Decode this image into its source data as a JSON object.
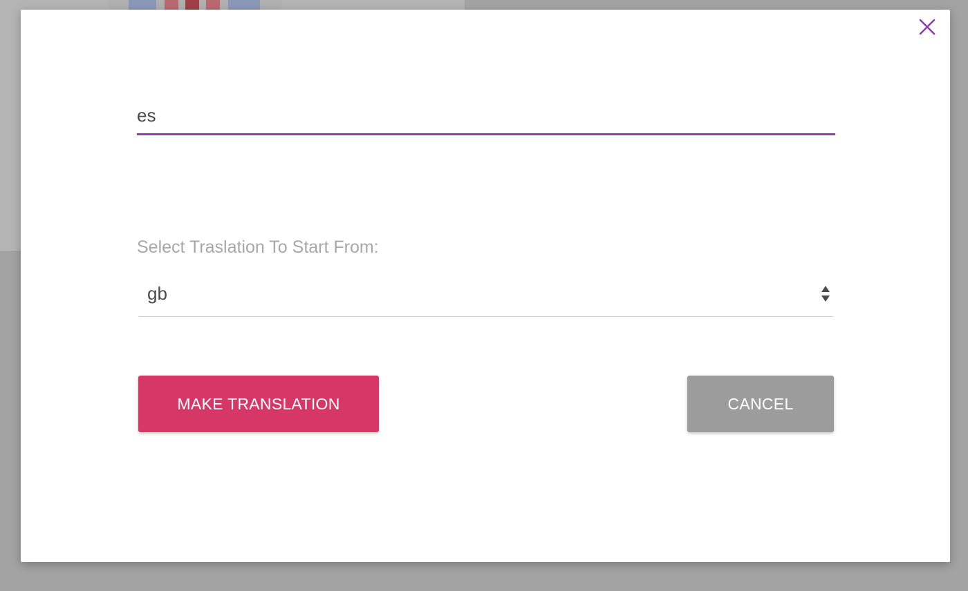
{
  "dialog": {
    "language_code_value": "es",
    "select_label": "Select Traslation To Start From:",
    "select_value": "gb",
    "make_translation_label": "MAKE TRANSLATION",
    "cancel_label": "CANCEL",
    "close_icon": "close-icon",
    "select_icon": "select-arrows-icon"
  },
  "colors": {
    "accent_purple": "#8e3eaa",
    "primary_button": "#d63767",
    "cancel_button": "#9c9c9c",
    "overlay": "#a3a3a3"
  }
}
